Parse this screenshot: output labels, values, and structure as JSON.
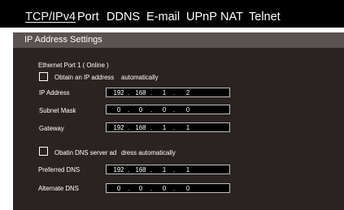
{
  "tabs": [
    "TCP/IPv4",
    "Port",
    "DDNS",
    "E-mail",
    "UPnP",
    "NAT",
    "Telnet"
  ],
  "section_title": "IP Address Settings",
  "ethernet_label": "Ethernet Port 1 ( Online )",
  "auto_ip": {
    "label_a": "Obtain an IP address",
    "label_b": "automatically",
    "checked": false
  },
  "ip_address": {
    "label": "IP Address",
    "octets": [
      "192",
      "168",
      "1",
      "2"
    ]
  },
  "subnet_mask": {
    "label": "Subnet Mask",
    "octets": [
      "0",
      "0",
      "0",
      "0"
    ]
  },
  "gateway": {
    "label": "Gateway",
    "octets": [
      "192",
      "168",
      "1",
      "1"
    ]
  },
  "auto_dns": {
    "label_a": "Obatin DNS server ad",
    "label_b": "dress automatically",
    "checked": false
  },
  "preferred_dns": {
    "label": "Preferred DNS",
    "octets": [
      "192",
      "168",
      "1",
      "1"
    ]
  },
  "alternate_dns": {
    "label": "Alternate DNS",
    "octets": [
      "0",
      "0",
      "0",
      "0"
    ]
  },
  "colors": {
    "tab_bar": "#000000",
    "panel": "#2a2322",
    "header": "#5a5352",
    "text": "#ffffff"
  }
}
